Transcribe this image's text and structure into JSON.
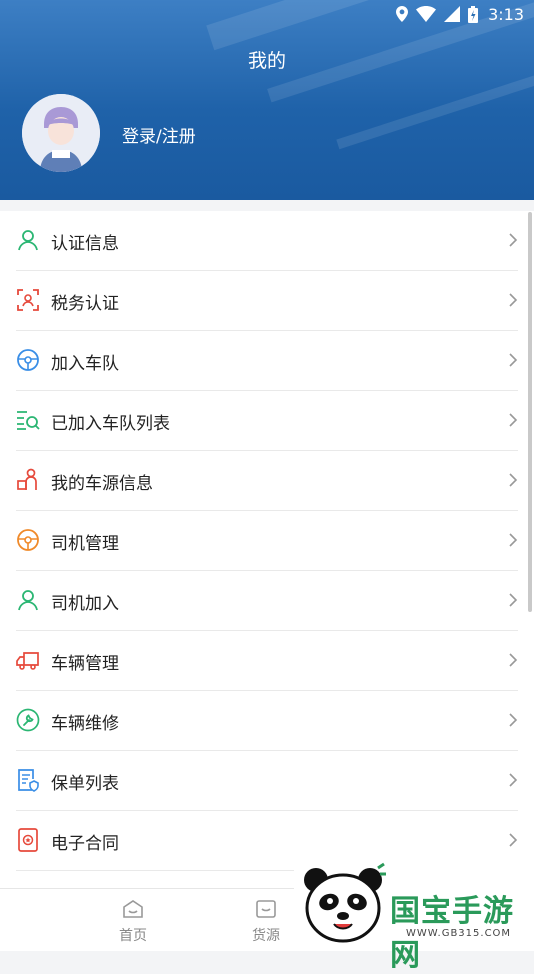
{
  "status_bar": {
    "time": "3:13"
  },
  "header": {
    "title": "我的",
    "login_label": "登录/注册"
  },
  "menu": [
    {
      "label": "认证信息",
      "icon": "person-icon",
      "color": "#2bb673"
    },
    {
      "label": "税务认证",
      "icon": "face-scan-icon",
      "color": "#e64a3c"
    },
    {
      "label": "加入车队",
      "icon": "steering-wheel-icon",
      "color": "#3a8ee6"
    },
    {
      "label": "已加入车队列表",
      "icon": "list-search-icon",
      "color": "#2bb673"
    },
    {
      "label": "我的车源信息",
      "icon": "cargo-person-icon",
      "color": "#e64a3c"
    },
    {
      "label": "司机管理",
      "icon": "steering-wheel-icon",
      "color": "#f08a2a"
    },
    {
      "label": "司机加入",
      "icon": "person-icon",
      "color": "#2bb673"
    },
    {
      "label": "车辆管理",
      "icon": "truck-icon",
      "color": "#e64a3c"
    },
    {
      "label": "车辆维修",
      "icon": "wrench-icon",
      "color": "#2bb673"
    },
    {
      "label": "保单列表",
      "icon": "policy-document-icon",
      "color": "#3a8ee6"
    },
    {
      "label": "电子合同",
      "icon": "contract-stamp-icon",
      "color": "#e64a3c"
    }
  ],
  "tabs": [
    {
      "label": "首页",
      "icon": "home-icon"
    },
    {
      "label": "货源",
      "icon": "cargo-icon"
    }
  ],
  "watermark": {
    "text": "国宝手游网",
    "sub": "WWW.GB315.COM"
  }
}
